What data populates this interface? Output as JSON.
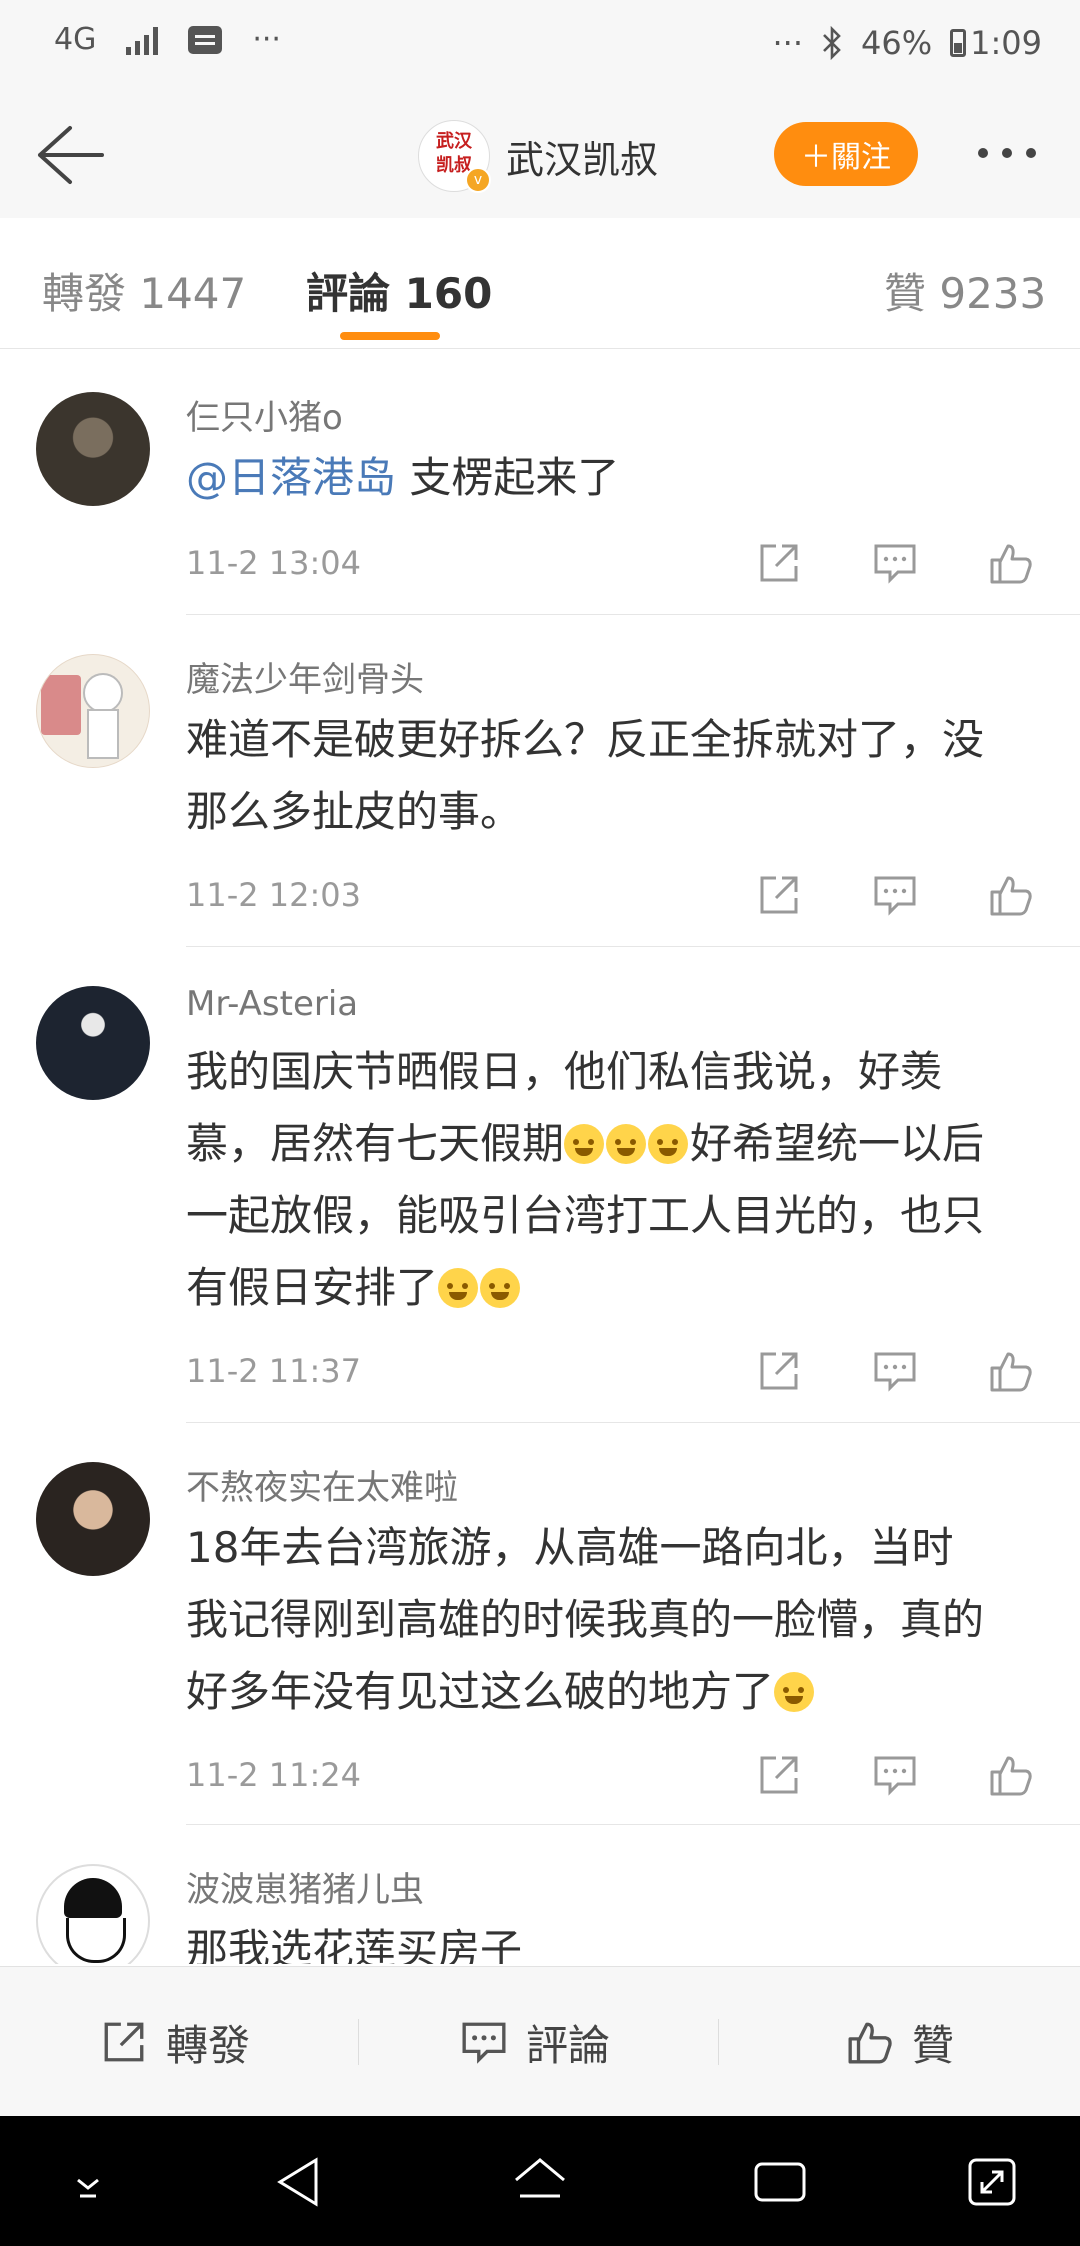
{
  "status_bar": {
    "network": "4G",
    "more_left": "···",
    "more_right": "···",
    "battery": "46%",
    "time": "1:09"
  },
  "header": {
    "logo_text": "武汉凯叔",
    "account_name": "武汉凯叔",
    "follow_label": "＋關注"
  },
  "tabs": {
    "repost": "轉發 1447",
    "comments": "評論 160",
    "likes": "贊 9233"
  },
  "comments": [
    {
      "user": "仨只小猪o",
      "mention": "@日落港岛",
      "text": " 支楞起来了",
      "time": "11-2 13:04"
    },
    {
      "user": "魔法少年剑骨头",
      "lines": [
        "难道不是破更好拆么？反正全拆就对了，没",
        "那么多扯皮的事。"
      ],
      "time": "11-2 12:03"
    },
    {
      "user": "Mr-Asteria",
      "lines": [
        "我的国庆节晒假日，他们私信我说，好羡",
        "慕，居然有七天假期",
        "好希望统一以后",
        "一起放假，能吸引台湾打工人目光的，也只",
        "有假日安排了"
      ],
      "time": "11-2 11:37"
    },
    {
      "user": "不熬夜实在太难啦",
      "lines": [
        "18年去台湾旅游，从高雄一路向北，当时",
        "我记得刚到高雄的时候我真的一脸懵，真的",
        "好多年没有见过这么破的地方了"
      ],
      "time": "11-2 11:24"
    },
    {
      "user": "波波崽猪猪儿虫",
      "lines": [
        "那我选花莲买房子"
      ]
    }
  ],
  "action_bar": {
    "repost": "轉發",
    "comment": "評論",
    "like": "贊"
  },
  "colors": {
    "accent": "#ff8d0f",
    "mention": "#4a7ab8",
    "background": "#ffffff",
    "bar_background": "#f7f7f7"
  }
}
